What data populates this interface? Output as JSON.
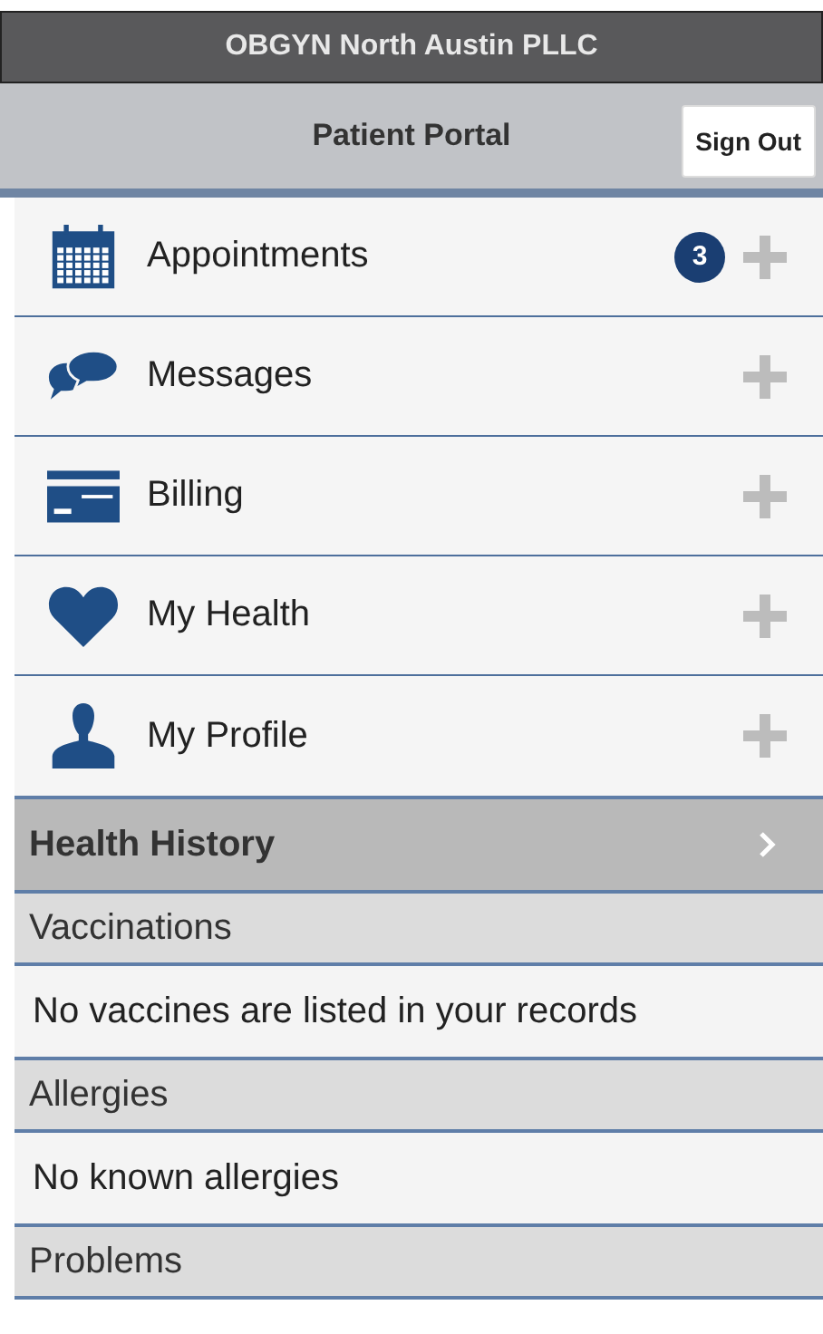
{
  "header": {
    "title": "OBGYN North Austin PLLC"
  },
  "toolbar": {
    "title": "Patient Portal",
    "button": "Sign Out"
  },
  "menu": [
    {
      "kind": "calendar",
      "label": "Appointments",
      "badge": "3"
    },
    {
      "kind": "chat",
      "label": "Messages"
    },
    {
      "kind": "card",
      "label": "Billing"
    },
    {
      "kind": "heart",
      "label": "My Health"
    },
    {
      "kind": "person",
      "label": "My Profile"
    }
  ],
  "section": {
    "title": "Health History"
  },
  "history": [
    {
      "kind": "heading",
      "text": "Vaccinations"
    },
    {
      "kind": "entry",
      "text": "No vaccines are listed in your records"
    },
    {
      "kind": "heading",
      "text": "Allergies"
    },
    {
      "kind": "entry",
      "text": "No known allergies"
    },
    {
      "kind": "heading",
      "text": "Problems"
    }
  ]
}
